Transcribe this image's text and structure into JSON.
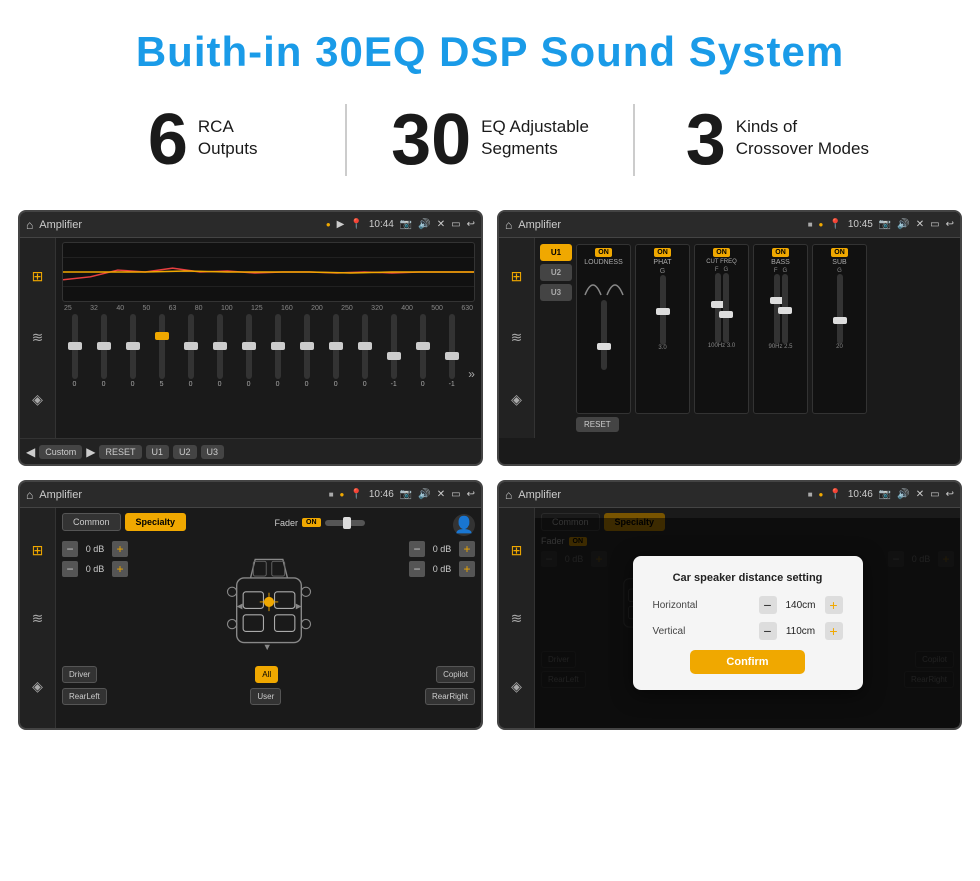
{
  "page": {
    "title": "Buith-in 30EQ DSP Sound System",
    "stats": [
      {
        "number": "6",
        "label": "RCA\nOutputs"
      },
      {
        "number": "30",
        "label": "EQ Adjustable\nSegments"
      },
      {
        "number": "3",
        "label": "Kinds of\nCrossover Modes"
      }
    ]
  },
  "screens": {
    "screen1": {
      "header": {
        "title": "Amplifier",
        "time": "10:44"
      },
      "freq_labels": [
        "25",
        "32",
        "40",
        "50",
        "63",
        "80",
        "100",
        "125",
        "160",
        "200",
        "250",
        "320",
        "400",
        "500",
        "630"
      ],
      "slider_values": [
        "0",
        "0",
        "0",
        "5",
        "0",
        "0",
        "0",
        "0",
        "0",
        "0",
        "0",
        "-1",
        "0",
        "-1"
      ],
      "buttons": [
        "Custom",
        "RESET",
        "U1",
        "U2",
        "U3"
      ]
    },
    "screen2": {
      "header": {
        "title": "Amplifier",
        "time": "10:45"
      },
      "presets": [
        "U1",
        "U2",
        "U3"
      ],
      "channels": [
        "LOUDNESS",
        "PHAT",
        "CUT FREQ",
        "BASS",
        "SUB"
      ],
      "reset_label": "RESET"
    },
    "screen3": {
      "header": {
        "title": "Amplifier",
        "time": "10:46"
      },
      "tabs": [
        "Common",
        "Specialty"
      ],
      "fader_label": "Fader",
      "fader_on": "ON",
      "db_values": [
        "0 dB",
        "0 dB",
        "0 dB",
        "0 dB"
      ],
      "buttons": {
        "driver": "Driver",
        "all": "All",
        "copilot": "Copilot",
        "rear_left": "RearLeft",
        "user": "User",
        "rear_right": "RearRight"
      }
    },
    "screen4": {
      "header": {
        "title": "Amplifier",
        "time": "10:46"
      },
      "tabs": [
        "Common",
        "Specialty"
      ],
      "dialog": {
        "title": "Car speaker distance setting",
        "horizontal_label": "Horizontal",
        "horizontal_value": "140cm",
        "vertical_label": "Vertical",
        "vertical_value": "110cm",
        "confirm_label": "Confirm"
      },
      "buttons": {
        "driver": "Driver",
        "copilot": "Copilot",
        "rear_left": "RearLeft",
        "user": "User",
        "rear_right": "RearRight"
      }
    }
  },
  "icons": {
    "home": "⌂",
    "location": "📍",
    "camera": "📷",
    "volume": "🔊",
    "back": "↩",
    "eq_icon": "≡",
    "wave_icon": "≋",
    "speaker_icon": "◈"
  }
}
